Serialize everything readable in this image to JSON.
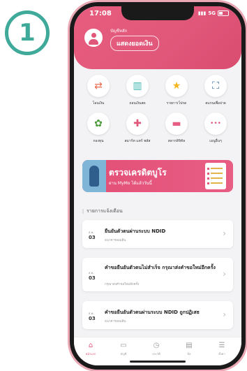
{
  "step_badge": "1",
  "status": {
    "time": "17:08",
    "network": "5G"
  },
  "header": {
    "account_label": "บัญชีหลัก",
    "balance_button": "แสดงยอดเงิน"
  },
  "menu": [
    {
      "label": "โอนเงิน",
      "icon": "transfer-icon",
      "glyph": "⇄",
      "color": "#e86b4a"
    },
    {
      "label": "ถอนเงินสด",
      "icon": "cash-withdraw-icon",
      "glyph": "▥",
      "color": "#3fb5b0"
    },
    {
      "label": "รายการโปรด",
      "icon": "star-icon",
      "glyph": "★",
      "color": "#f2b51c"
    },
    {
      "label": "สแกนเพื่อจ่าย",
      "icon": "scan-icon",
      "glyph": "⛶",
      "color": "#3a6ea5"
    },
    {
      "label": "กองทุน",
      "icon": "fund-plant-icon",
      "glyph": "✿",
      "color": "#4c9a3b"
    },
    {
      "label": "สมาร์ท แคร์ พลัส",
      "icon": "smart-care-icon",
      "glyph": "✚",
      "color": "#e0577a"
    },
    {
      "label": "สลากดิจิทัล",
      "icon": "digital-lottery-icon",
      "glyph": "▬",
      "color": "#e85d84"
    },
    {
      "label": "เมนูอื่นๆ",
      "icon": "more-menu-icon",
      "glyph": "•••",
      "color": "#e0577a"
    }
  ],
  "banner": {
    "title": "ตรวจเครดิตบูโร",
    "subtitle": "ผ่าน MyMo ได้แล้ววันนี้"
  },
  "notifications": {
    "section_title": "รายการแจ้งเตือน",
    "items": [
      {
        "month": "ส.ค.",
        "day": "03",
        "title": "ยืนยันตัวตนผ่านระบบ NDID",
        "subtitle": "ธนาคารออมสิน"
      },
      {
        "month": "ส.ค.",
        "day": "03",
        "title": "คำขอยืนยันตัวตนไม่สำเร็จ กรุณาส่งคำขอใหม่อีกครั้ง",
        "subtitle": "กรุณาส่งคำขอใหม่อีกครั้ง"
      },
      {
        "month": "ส.ค.",
        "day": "03",
        "title": "คำขอยืนยันตัวตนผ่านระบบ NDID ถูกปฏิเสธ",
        "subtitle": "ธนาคารออมสิน"
      }
    ]
  },
  "tabs": [
    {
      "label": "หน้าแรก",
      "icon": "home-icon",
      "glyph": "⌂"
    },
    {
      "label": "บัญชี",
      "icon": "account-icon",
      "glyph": "▭"
    },
    {
      "label": "ประวัติ",
      "icon": "history-clock-icon",
      "glyph": "◷"
    },
    {
      "label": "บิล",
      "icon": "bill-icon",
      "glyph": "▤"
    },
    {
      "label": "ตั้งค่า",
      "icon": "settings-menu-icon",
      "glyph": "☰"
    }
  ],
  "colors": {
    "accent": "#e0577a",
    "badge": "#3fa99a"
  }
}
